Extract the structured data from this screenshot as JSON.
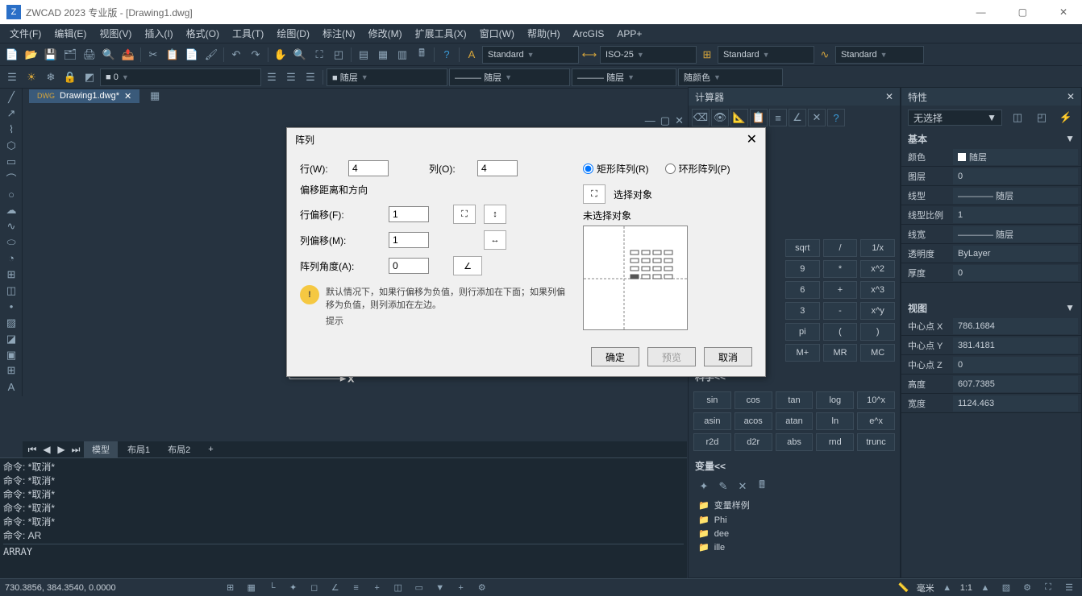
{
  "titlebar": {
    "app": "ZWCAD 2023 专业版 - [Drawing1.dwg]"
  },
  "menu": [
    "文件(F)",
    "编辑(E)",
    "视图(V)",
    "插入(I)",
    "格式(O)",
    "工具(T)",
    "绘图(D)",
    "标注(N)",
    "修改(M)",
    "扩展工具(X)",
    "窗口(W)",
    "帮助(H)",
    "ArcGIS",
    "APP+"
  ],
  "toolbar1_dd": {
    "std1": "Standard",
    "iso": "ISO-25",
    "std2": "Standard",
    "std3": "Standard"
  },
  "toolbar2": {
    "layer0": "0",
    "col": "随层",
    "lt": "随层",
    "lw": "随层",
    "color": "随颜色"
  },
  "doc_tab": "Drawing1.dwg*",
  "mini": {
    "min": "—",
    "max": "▢",
    "close": "✕"
  },
  "calc": {
    "title": "计算器",
    "row1": [
      "sqrt",
      "/",
      "1/x"
    ],
    "row2": [
      "9",
      "*",
      "x^2"
    ],
    "row3": [
      "6",
      "+",
      "x^3"
    ],
    "row4": [
      "3",
      "-",
      "x^y"
    ],
    "row5": [
      "pi",
      "(",
      ")"
    ],
    "row6": [
      "M+",
      "MR",
      "MC"
    ],
    "science": "科学<<",
    "sci1": [
      "sin",
      "cos",
      "tan",
      "log",
      "10^x"
    ],
    "sci2": [
      "asin",
      "acos",
      "atan",
      "ln",
      "e^x"
    ],
    "sci3": [
      "r2d",
      "d2r",
      "abs",
      "rnd",
      "trunc"
    ],
    "vars": "变量<<",
    "var_items": [
      "变量样例",
      "Phi",
      "dee",
      "ille"
    ]
  },
  "props": {
    "title": "特性",
    "selection": "无选择",
    "basic": "基本",
    "rows": [
      {
        "k": "颜色",
        "v": "随层",
        "sw": true
      },
      {
        "k": "图层",
        "v": "0"
      },
      {
        "k": "线型",
        "v": "———— 随层"
      },
      {
        "k": "线型比例",
        "v": "1"
      },
      {
        "k": "线宽",
        "v": "———— 随层"
      },
      {
        "k": "透明度",
        "v": "ByLayer"
      },
      {
        "k": "厚度",
        "v": "0"
      }
    ],
    "view": "视图",
    "view_rows": [
      {
        "k": "中心点 X",
        "v": "786.1684"
      },
      {
        "k": "中心点 Y",
        "v": "381.4181"
      },
      {
        "k": "中心点 Z",
        "v": "0"
      },
      {
        "k": "高度",
        "v": "607.7385"
      },
      {
        "k": "宽度",
        "v": "1124.463"
      }
    ]
  },
  "layout": {
    "tabs": [
      "模型",
      "布局1",
      "布局2"
    ],
    "plus": "+"
  },
  "cmd": {
    "lines": [
      "命令: *取消*",
      "命令: *取消*",
      "命令: *取消*",
      "命令: *取消*",
      "命令: *取消*",
      "命令: AR"
    ],
    "input": "ARRAY"
  },
  "status": {
    "coords": "730.3856, 384.3540, 0.0000",
    "unit": "毫米",
    "ratio": "1:1"
  },
  "dialog": {
    "title": "阵列",
    "rows_label": "行(W):",
    "rows_val": "4",
    "cols_label": "列(O):",
    "cols_val": "4",
    "offset_group": "偏移距离和方向",
    "row_offset_label": "行偏移(F):",
    "row_offset_val": "1",
    "col_offset_label": "列偏移(M):",
    "col_offset_val": "1",
    "angle_label": "阵列角度(A):",
    "angle_val": "0",
    "hint_title": "提示",
    "hint_text": "默认情况下，如果行偏移为负值，则行添加在下面；如果列偏移为负值，则列添加在左边。",
    "rect_radio": "矩形阵列(R)",
    "polar_radio": "环形阵列(P)",
    "select_obj": "选择对象",
    "no_select": "未选择对象",
    "ok": "确定",
    "preview": "预览",
    "cancel": "取消"
  }
}
